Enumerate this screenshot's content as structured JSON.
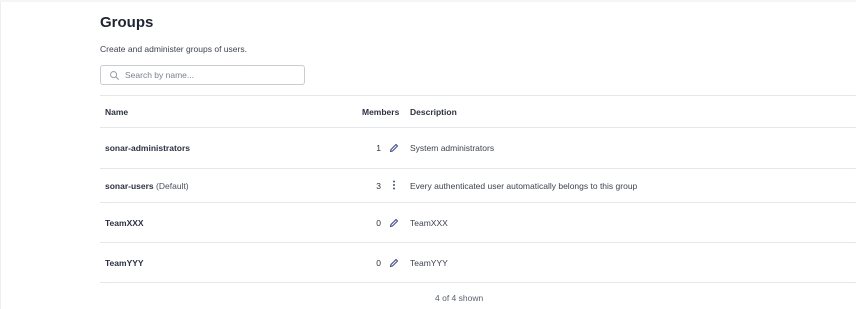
{
  "page": {
    "title": "Groups",
    "subtitle": "Create and administer groups of users."
  },
  "search": {
    "placeholder": "Search by name..."
  },
  "table": {
    "columns": [
      "Name",
      "Members",
      "Description"
    ],
    "rows": [
      {
        "name": "sonar-administrators",
        "suffix": "",
        "members": "1",
        "action_icon": "pencil-icon",
        "description": "System administrators"
      },
      {
        "name": "sonar-users",
        "suffix": "(Default)",
        "members": "3",
        "action_icon": "more-vertical-icon",
        "description": "Every authenticated user automatically belongs to this group"
      },
      {
        "name": "TeamXXX",
        "suffix": "",
        "members": "0",
        "action_icon": "pencil-icon",
        "description": "TeamXXX"
      },
      {
        "name": "TeamYYY",
        "suffix": "",
        "members": "0",
        "action_icon": "pencil-icon",
        "description": "TeamYYY"
      }
    ]
  },
  "footer": {
    "count_text": "4 of 4 shown"
  },
  "colors": {
    "text": "#2b3246",
    "border": "#e5e7ec",
    "icon_accent": "#3e4a9e"
  }
}
